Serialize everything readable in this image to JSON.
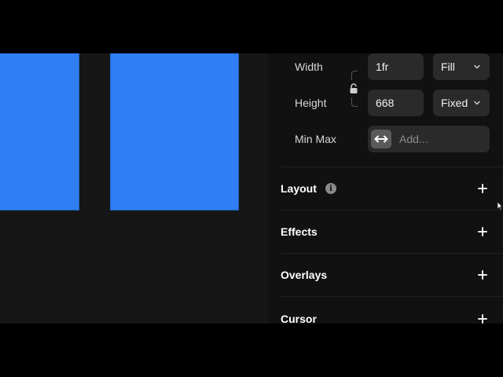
{
  "size": {
    "width_label": "Width",
    "width_value": "1fr",
    "width_mode": "Fill",
    "height_label": "Height",
    "height_value": "668",
    "height_mode": "Fixed",
    "minmax_label": "Min Max",
    "minmax_placeholder": "Add..."
  },
  "sections": {
    "layout": "Layout",
    "effects": "Effects",
    "overlays": "Overlays",
    "cursor": "Cursor"
  },
  "icons": {
    "lock": "lock-icon",
    "chevron": "chevron-down-icon",
    "minmax": "arrows-horizontal-icon",
    "info": "info-icon",
    "add": "plus-icon"
  },
  "colors": {
    "frame_fill": "#2f7ef5",
    "canvas_bg": "#161616",
    "panel_bg": "#111111",
    "field_bg": "#2a2a2a"
  }
}
